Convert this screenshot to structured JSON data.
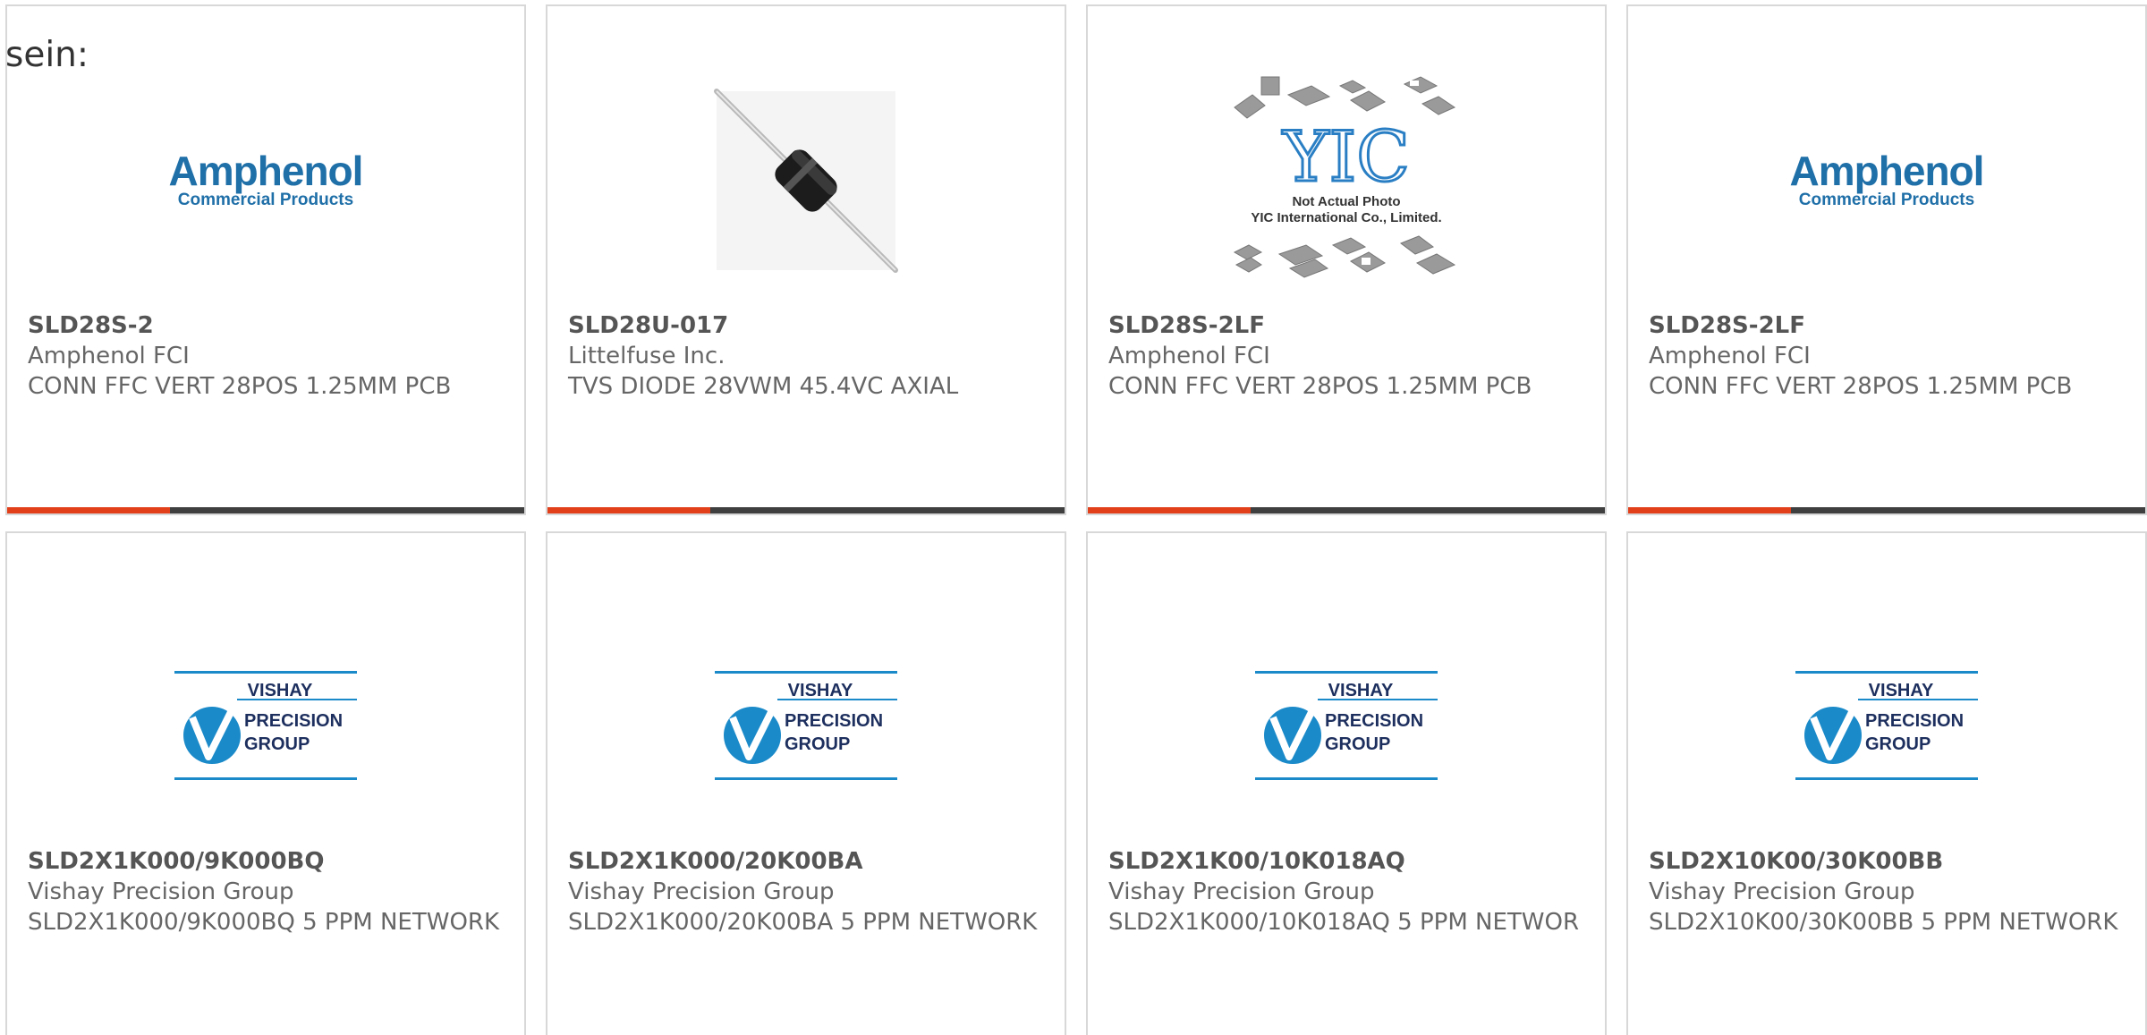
{
  "lead_text": "sein:",
  "colors": {
    "accent_bar": "#e2401b",
    "dark_bar": "#3f3f3f",
    "card_border": "#d8d8d8",
    "amphenol_blue": "#1f6fa8",
    "vishay_blue": "#1b8ac9"
  },
  "logos": {
    "amphenol": {
      "name": "Amphenol",
      "sub": "Commercial Products"
    },
    "yic": {
      "mark": "YIC",
      "line1": "Not Actual Photo",
      "line2": "YIC International Co., Limited."
    },
    "vishay": {
      "line1": "VISHAY",
      "line2": "PRECISION",
      "line3": "GROUP"
    }
  },
  "products": [
    {
      "image": "amphenol-logo",
      "part_number": "SLD28S-2",
      "manufacturer": "Amphenol FCI",
      "description": "CONN FFC VERT 28POS 1.25MM PCB"
    },
    {
      "image": "axial-diode-photo",
      "part_number": "SLD28U-017",
      "manufacturer": "Littelfuse Inc.",
      "description": "TVS DIODE 28VWM 45.4VC AXIAL"
    },
    {
      "image": "yic-placeholder",
      "part_number": "SLD28S-2LF",
      "manufacturer": "Amphenol FCI",
      "description": "CONN FFC VERT 28POS 1.25MM PCB"
    },
    {
      "image": "amphenol-logo",
      "part_number": "SLD28S-2LF",
      "manufacturer": "Amphenol FCI",
      "description": "CONN FFC VERT 28POS 1.25MM PCB"
    },
    {
      "image": "vishay-logo",
      "part_number": "SLD2X1K000/9K000BQ",
      "manufacturer": "Vishay Precision Group",
      "description": "SLD2X1K000/9K000BQ 5 PPM NETWORK"
    },
    {
      "image": "vishay-logo",
      "part_number": "SLD2X1K000/20K00BA",
      "manufacturer": "Vishay Precision Group",
      "description": "SLD2X1K000/20K00BA 5 PPM NETWORK"
    },
    {
      "image": "vishay-logo",
      "part_number": "SLD2X1K00/10K018AQ",
      "manufacturer": "Vishay Precision Group",
      "description": "SLD2X1K000/10K018AQ 5 PPM NETWOR"
    },
    {
      "image": "vishay-logo",
      "part_number": "SLD2X10K00/30K00BB",
      "manufacturer": "Vishay Precision Group",
      "description": "SLD2X10K00/30K00BB 5 PPM NETWORK"
    }
  ]
}
